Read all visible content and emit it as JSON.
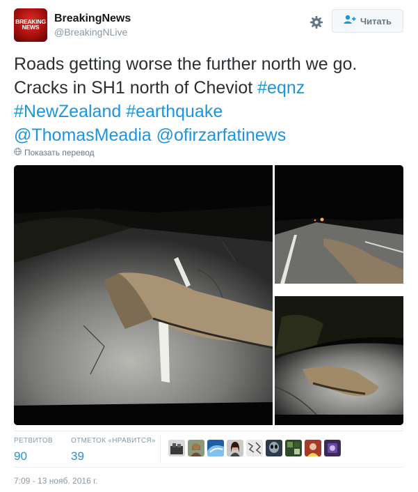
{
  "author": {
    "display_name": "BreakingNews",
    "handle": "@BreakingNLive",
    "avatar_logo_line1": "BREAKING",
    "avatar_logo_line2": "NEWS"
  },
  "actions": {
    "settings_icon": "gear-icon",
    "follow_label": "Читать",
    "follow_icon": "add-user-icon"
  },
  "tweet": {
    "text_part1": "Roads getting worse the further north we go. Cracks in SH1 north of Cheviot",
    "hashtag1": "#eqnz",
    "hashtag2": "#NewZealand",
    "hashtag3": "#earthquake",
    "mention1": "@ThomasMeadia",
    "mention2": "@ofirzarfatinews",
    "translate_label": "Показать перевод"
  },
  "stats": {
    "retweets_label": "РЕТВИТОВ",
    "retweets_count": "90",
    "likes_label": "ОТМЕТОК «НРАВИТСЯ»",
    "likes_count": "39",
    "liker_count": 9
  },
  "timestamp": "7:09 - 13 нояб. 2016 г.",
  "colors": {
    "link": "#1b95e0",
    "text": "#292f33",
    "muted": "#8899a6",
    "brand_red": "#c4161c"
  }
}
